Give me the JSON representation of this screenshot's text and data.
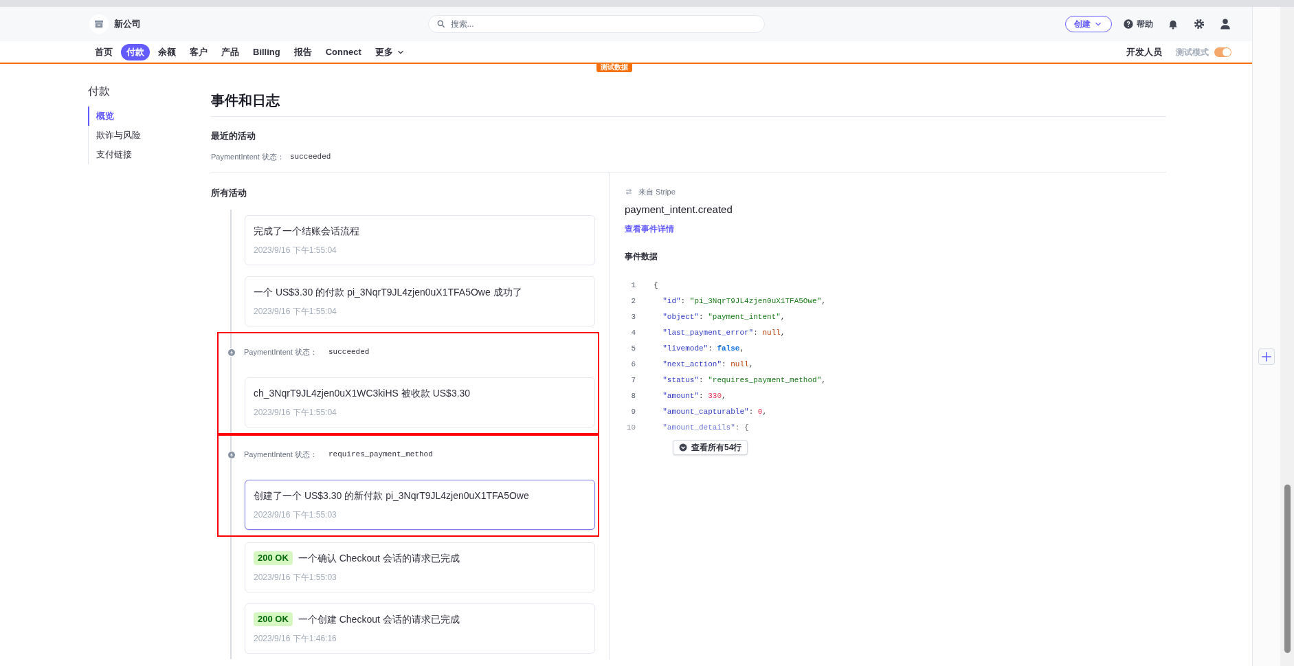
{
  "header": {
    "company": "新公司",
    "search": {
      "placeholder": "搜索..."
    },
    "create_button": "创建",
    "help": "帮助"
  },
  "nav": {
    "items": [
      {
        "label": "首页",
        "selected": false
      },
      {
        "label": "付款",
        "selected": true
      },
      {
        "label": "余额",
        "selected": false
      },
      {
        "label": "客户",
        "selected": false
      },
      {
        "label": "产品",
        "selected": false
      },
      {
        "label": "Billing",
        "selected": false
      },
      {
        "label": "报告",
        "selected": false
      },
      {
        "label": "Connect",
        "selected": false
      }
    ],
    "more": "更多",
    "developers": "开发人员",
    "test_mode": {
      "label": "测试模式",
      "on": true
    }
  },
  "test_data_badge": "测试数据",
  "sidebar": {
    "title": "付款",
    "items": [
      {
        "label": "概览",
        "selected": true
      },
      {
        "label": "欺诈与风险",
        "selected": false
      },
      {
        "label": "支付链接",
        "selected": false
      }
    ]
  },
  "page_title": "事件和日志",
  "recent": {
    "title": "最近的活动",
    "status_label": "PaymentIntent 状态：",
    "status_value": "succeeded"
  },
  "all_activity": {
    "title": "所有活动",
    "groups": [
      {
        "annotated": false,
        "items": [
          {
            "kind": "event",
            "title": "完成了一个结账会话流程",
            "time": "2023/9/16 下午1:55:04",
            "selected": false
          },
          {
            "kind": "event",
            "title": "一个 US$3.30 的付款 pi_3NqrT9JL4zjen0uX1TFA5Owe 成功了",
            "time": "2023/9/16 下午1:55:04",
            "selected": false
          }
        ]
      },
      {
        "annotated": true,
        "items": [
          {
            "kind": "status",
            "label": "PaymentIntent 状态：",
            "value": "succeeded"
          },
          {
            "kind": "event",
            "title": "ch_3NqrT9JL4zjen0uX1WC3kiHS 被收款 US$3.30",
            "time": "2023/9/16 下午1:55:04",
            "selected": false
          }
        ]
      },
      {
        "annotated": true,
        "items": [
          {
            "kind": "status",
            "label": "PaymentIntent 状态：",
            "value": "requires_payment_method"
          },
          {
            "kind": "event",
            "title": "创建了一个 US$3.30 的新付款 pi_3NqrT9JL4zjen0uX1TFA5Owe",
            "time": "2023/9/16 下午1:55:03",
            "selected": true
          }
        ]
      },
      {
        "annotated": false,
        "items": [
          {
            "kind": "event",
            "badge": "200 OK",
            "title": "一个确认 Checkout 会话的请求已完成",
            "time": "2023/9/16 下午1:55:03",
            "selected": false
          },
          {
            "kind": "event",
            "badge": "200 OK",
            "title": "一个创建 Checkout 会话的请求已完成",
            "time": "2023/9/16 下午1:46:16",
            "selected": false
          }
        ]
      }
    ]
  },
  "detail": {
    "source": "来自 Stripe",
    "event_name": "payment_intent.created",
    "link": "查看事件详情",
    "data_title": "事件数据",
    "lines": [
      {
        "num": "1",
        "faded": false,
        "tokens": [
          {
            "kind": "punct",
            "text": "{"
          }
        ]
      },
      {
        "num": "2",
        "faded": false,
        "tokens": [
          {
            "kind": "key",
            "text": "  \"id\""
          },
          {
            "kind": "punct",
            "text": ": "
          },
          {
            "kind": "string",
            "text": "\"pi_3NqrT9JL4zjen0uX1TFA5Owe\""
          },
          {
            "kind": "punct",
            "text": ","
          }
        ]
      },
      {
        "num": "3",
        "faded": false,
        "tokens": [
          {
            "kind": "key",
            "text": "  \"object\""
          },
          {
            "kind": "punct",
            "text": ": "
          },
          {
            "kind": "string",
            "text": "\"payment_intent\""
          },
          {
            "kind": "punct",
            "text": ","
          }
        ]
      },
      {
        "num": "4",
        "faded": false,
        "tokens": [
          {
            "kind": "key",
            "text": "  \"last_payment_error\""
          },
          {
            "kind": "punct",
            "text": ": "
          },
          {
            "kind": "null",
            "text": "null"
          },
          {
            "kind": "punct",
            "text": ","
          }
        ]
      },
      {
        "num": "5",
        "faded": false,
        "tokens": [
          {
            "kind": "key",
            "text": "  \"livemode\""
          },
          {
            "kind": "punct",
            "text": ": "
          },
          {
            "kind": "bool",
            "text": "false"
          },
          {
            "kind": "punct",
            "text": ","
          }
        ]
      },
      {
        "num": "6",
        "faded": false,
        "tokens": [
          {
            "kind": "key",
            "text": "  \"next_action\""
          },
          {
            "kind": "punct",
            "text": ": "
          },
          {
            "kind": "null",
            "text": "null"
          },
          {
            "kind": "punct",
            "text": ","
          }
        ]
      },
      {
        "num": "7",
        "faded": false,
        "tokens": [
          {
            "kind": "key",
            "text": "  \"status\""
          },
          {
            "kind": "punct",
            "text": ": "
          },
          {
            "kind": "string",
            "text": "\"requires_payment_method\""
          },
          {
            "kind": "punct",
            "text": ","
          }
        ]
      },
      {
        "num": "8",
        "faded": false,
        "tokens": [
          {
            "kind": "key",
            "text": "  \"amount\""
          },
          {
            "kind": "punct",
            "text": ": "
          },
          {
            "kind": "number",
            "text": "330"
          },
          {
            "kind": "punct",
            "text": ","
          }
        ]
      },
      {
        "num": "9",
        "faded": false,
        "tokens": [
          {
            "kind": "key",
            "text": "  \"amount_capturable\""
          },
          {
            "kind": "punct",
            "text": ": "
          },
          {
            "kind": "number",
            "text": "0"
          },
          {
            "kind": "punct",
            "text": ","
          }
        ]
      },
      {
        "num": "10",
        "faded": true,
        "tokens": [
          {
            "kind": "key",
            "text": "  \"amount_details\""
          },
          {
            "kind": "punct",
            "text": ": {"
          }
        ]
      }
    ],
    "show_all": "查看所有54行"
  }
}
